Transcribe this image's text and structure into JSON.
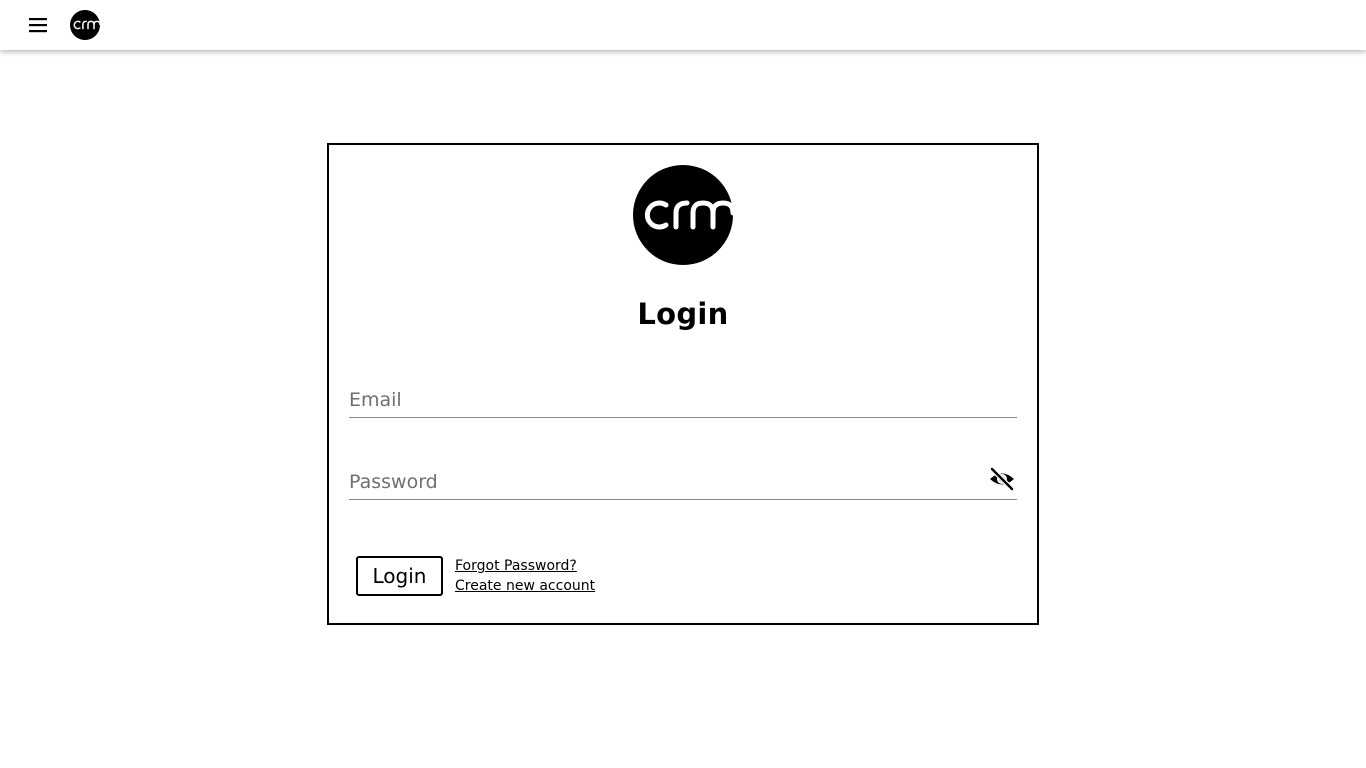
{
  "header": {
    "menu_icon": "hamburger-menu-icon",
    "logo_text": "crm"
  },
  "login_card": {
    "logo_text": "crm",
    "title": "Login",
    "email": {
      "placeholder": "Email",
      "value": ""
    },
    "password": {
      "placeholder": "Password",
      "value": "",
      "toggle_icon": "eye-off-icon"
    },
    "login_button_label": "Login",
    "forgot_password_link": "Forgot Password?",
    "create_account_link": "Create new account"
  },
  "colors": {
    "background": "#ffffff",
    "foreground": "#000000",
    "placeholder": "#6f6f6f",
    "underline": "#8a8a8a"
  }
}
